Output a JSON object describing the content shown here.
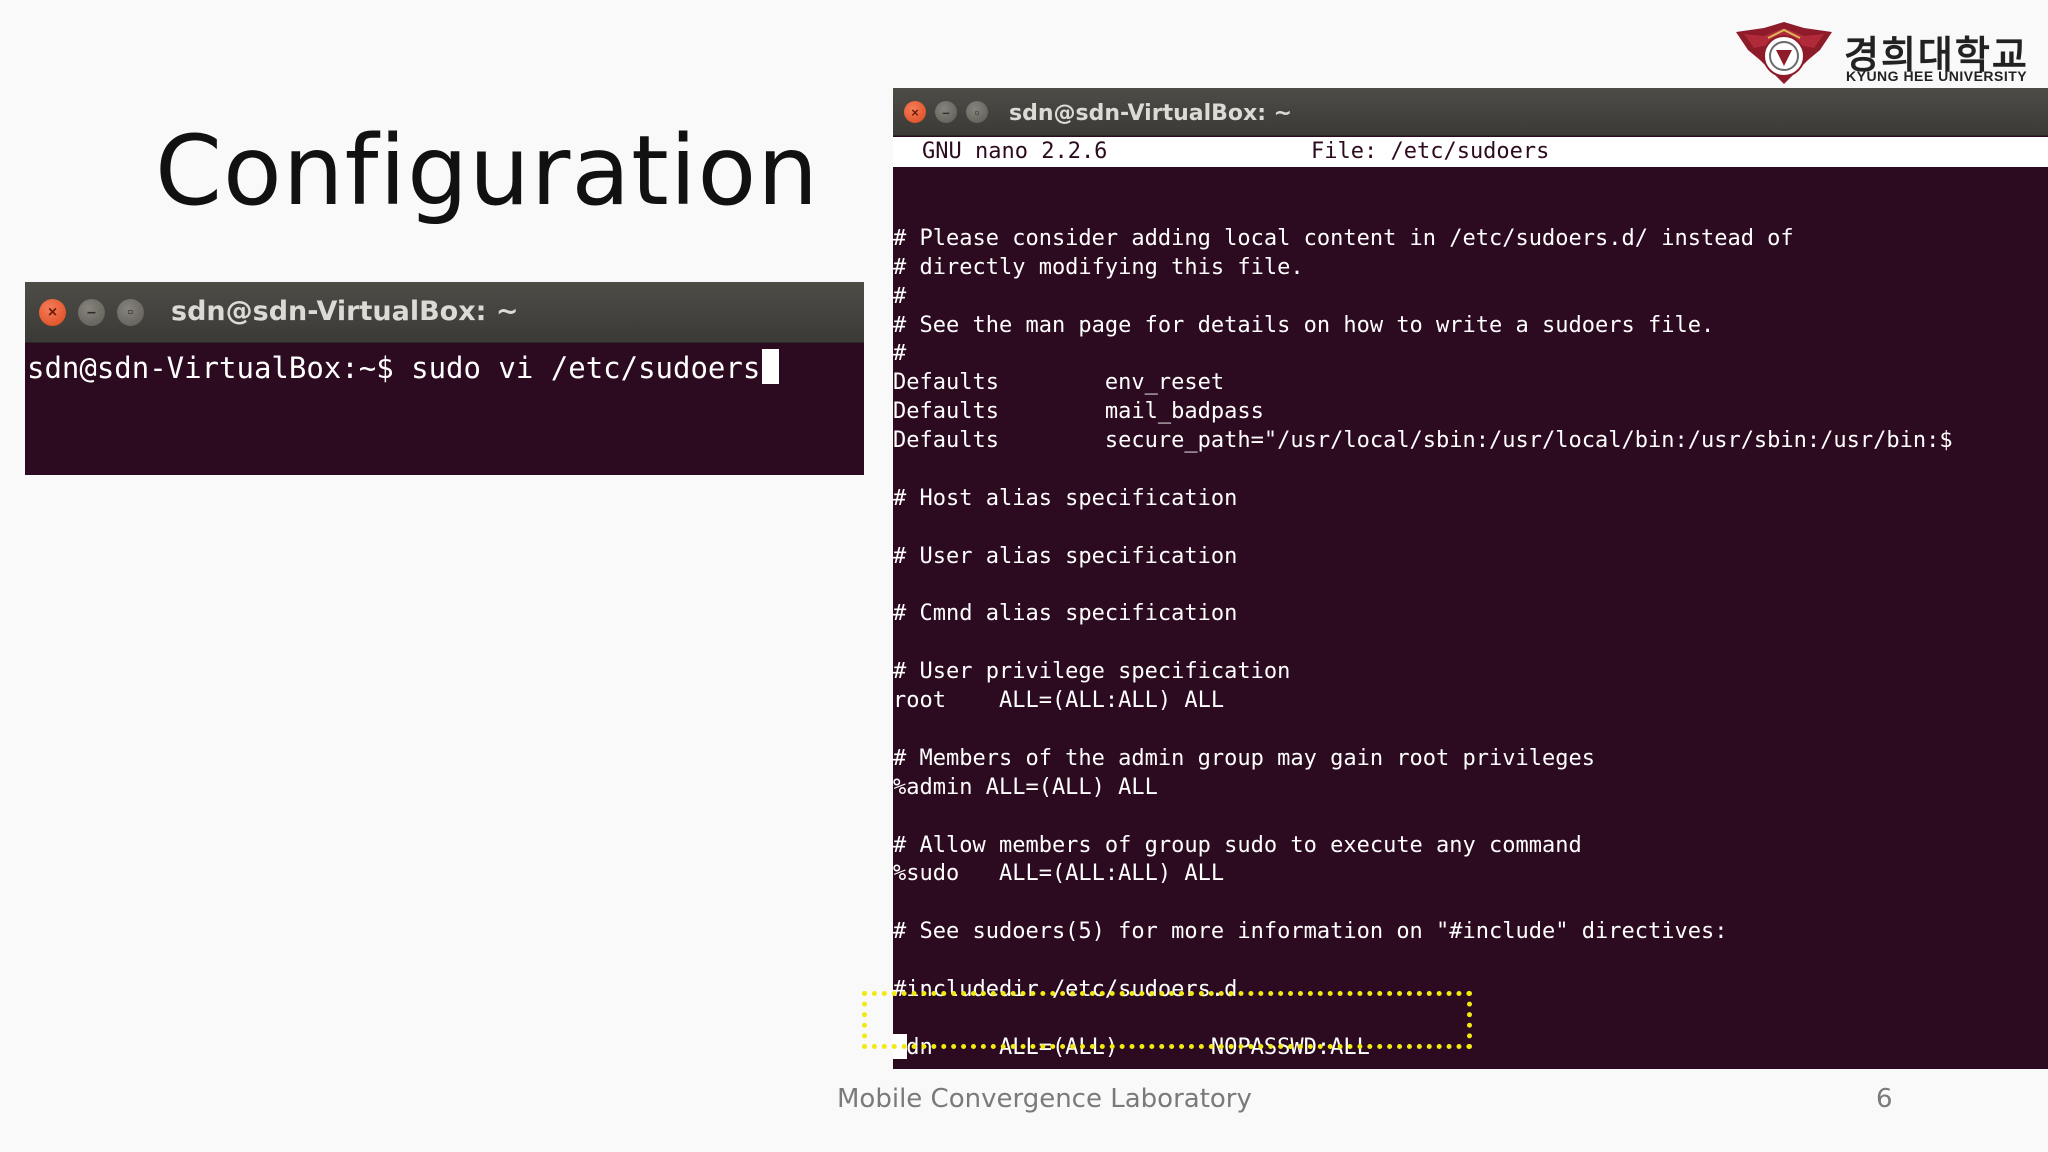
{
  "slide": {
    "title": "Configuration",
    "footer": "Mobile Convergence Laboratory",
    "page_number": "6"
  },
  "logo": {
    "korean": "경희대학교",
    "english": "KYUNG HEE UNIVERSITY"
  },
  "small_terminal": {
    "title": "sdn@sdn-VirtualBox: ~",
    "command_line": "sdn@sdn-VirtualBox:~$ sudo vi /etc/sudoers"
  },
  "big_terminal": {
    "title": "sdn@sdn-VirtualBox: ~",
    "nano_version": "GNU nano 2.2.6",
    "file_label": "File: /etc/sudoers",
    "lines": [
      "",
      "# Please consider adding local content in /etc/sudoers.d/ instead of",
      "# directly modifying this file.",
      "#",
      "# See the man page for details on how to write a sudoers file.",
      "#",
      "Defaults        env_reset",
      "Defaults        mail_badpass",
      "Defaults        secure_path=\"/usr/local/sbin:/usr/local/bin:/usr/sbin:/usr/bin:$",
      "",
      "# Host alias specification",
      "",
      "# User alias specification",
      "",
      "# Cmnd alias specification",
      "",
      "# User privilege specification",
      "root    ALL=(ALL:ALL) ALL",
      "",
      "# Members of the admin group may gain root privileges",
      "%admin ALL=(ALL) ALL",
      "",
      "# Allow members of group sudo to execute any command",
      "%sudo   ALL=(ALL:ALL) ALL",
      "",
      "# See sudoers(5) for more information on \"#include\" directives:",
      "",
      "#includedir /etc/sudoers.d",
      "",
      "sdn     ALL=(ALL)       NOPASSWD:ALL"
    ]
  },
  "colors": {
    "terminal_bg": "#2c0a1f",
    "highlight": "#f1ea12",
    "close_button": "#e95420"
  },
  "icons": {
    "close": "close-icon",
    "minimize": "minimize-icon",
    "maximize": "maximize-icon",
    "logo": "kyung-hee-emblem-icon"
  }
}
